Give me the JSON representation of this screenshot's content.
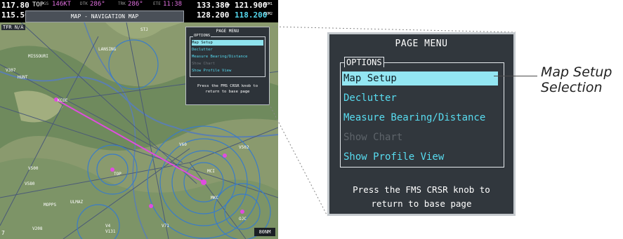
{
  "mfd": {
    "com": {
      "active1": "117.80",
      "standby1": "115.50",
      "label_tops": "TOP",
      "gs_label": "GS",
      "gs_value": "146KT",
      "dtk_label": "DTK",
      "dtk_value": "286°",
      "trk_label": "TRK",
      "trk_value": "286°",
      "ete_label": "ETE",
      "ete_value": "11:38",
      "com1_active": "133.380",
      "com1_standby": "121.900",
      "com1_tag": "COM1",
      "com2_active": "128.200",
      "com2_standby": "118.200",
      "com2_tag": "COM2",
      "nav_id": "STJ"
    },
    "page_title": "MAP - NAVIGATION MAP",
    "trfn": "TFR N/A",
    "scale": "80NM",
    "range_left": "7",
    "small_menu": {
      "title": "PAGE MENU",
      "legend": "OPTIONS",
      "items": [
        "Map Setup",
        "Declutter",
        "Measure Bearing/Distance",
        "Show Chart",
        "Show Profile View"
      ],
      "note": "Press the FMS CRSR knob to return to base page"
    },
    "map_labels": [
      "V307",
      "V500",
      "V580",
      "MOPPS",
      "ULMAZ",
      "TOP",
      "MKC",
      "V4",
      "V131",
      "V71",
      "V208",
      "STJ",
      "LANSING",
      "KCOE",
      "HUNT",
      "MISSOURI",
      "MCI",
      "OJC",
      "V60",
      "V502"
    ]
  },
  "menu": {
    "title": "PAGE MENU",
    "legend": "OPTIONS",
    "items": [
      {
        "label": "Map Setup",
        "state": "selected"
      },
      {
        "label": "Declutter",
        "state": "enabled"
      },
      {
        "label": "Measure Bearing/Distance",
        "state": "enabled"
      },
      {
        "label": "Show Chart",
        "state": "disabled"
      },
      {
        "label": "Show Profile View",
        "state": "enabled"
      }
    ],
    "note_line1": "Press the FMS CRSR knob to",
    "note_line2": "return to base page"
  },
  "callout": {
    "line1": "Map Setup",
    "line2": "Selection"
  },
  "colors": {
    "menu_bg": "#31373d",
    "option_text": "#58dcf0",
    "selection": "#93e6f2",
    "disabled": "#5e646a",
    "map_green": "#7a8f6a",
    "airway_blue": "#3a7cc8"
  }
}
